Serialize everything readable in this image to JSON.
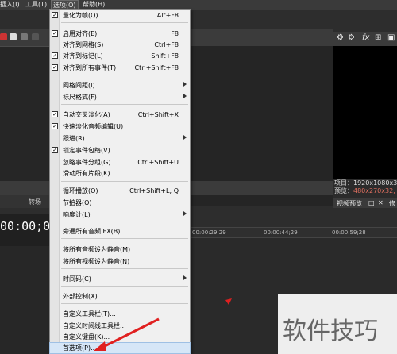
{
  "menubar": {
    "items": [
      "插入(I)",
      "工具(T)",
      "选项(O)",
      "帮助(H)"
    ]
  },
  "menu": {
    "items": [
      {
        "label": "量化为帧(Q)",
        "shortcut": "Alt+F8",
        "checked": true
      },
      {
        "label": "启用对齐(E)",
        "shortcut": "F8",
        "checked": true
      },
      {
        "label": "对齐到网格(S)",
        "shortcut": "Ctrl+F8",
        "checked": false
      },
      {
        "label": "对齐到标记(L)",
        "shortcut": "Shift+F8",
        "checked": true
      },
      {
        "label": "对齐到所有事件(T)",
        "shortcut": "Ctrl+Shift+F8",
        "checked": true
      },
      {
        "label": "网格间距(I)",
        "shortcut": "",
        "checked": false,
        "submenu": true
      },
      {
        "label": "标尺格式(F)",
        "shortcut": "",
        "checked": false,
        "submenu": true
      },
      {
        "label": "自动交叉淡化(A)",
        "shortcut": "Ctrl+Shift+X",
        "checked": true
      },
      {
        "label": "快速淡化音频编辑(U)",
        "shortcut": "",
        "checked": true
      },
      {
        "label": "跟进(R)",
        "shortcut": "",
        "checked": false,
        "submenu": true
      },
      {
        "label": "锁定事件包络(V)",
        "shortcut": "",
        "checked": true
      },
      {
        "label": "忽略事件分组(G)",
        "shortcut": "Ctrl+Shift+U",
        "checked": false
      },
      {
        "label": "滑动所有片段(K)",
        "shortcut": "",
        "checked": false
      },
      {
        "label": "循环播放(O)",
        "shortcut": "Ctrl+Shift+L; Q",
        "checked": false
      },
      {
        "label": "节拍器(O)",
        "shortcut": "",
        "checked": false
      },
      {
        "label": "响度计(L)",
        "shortcut": "",
        "checked": false,
        "submenu": true
      },
      {
        "label": "旁通所有音频 FX(B)",
        "shortcut": "",
        "checked": false
      },
      {
        "label": "将所有音频设为静音(M)",
        "shortcut": "",
        "checked": false
      },
      {
        "label": "将所有视频设为静音(N)",
        "shortcut": "",
        "checked": false
      },
      {
        "label": "时间码(C)",
        "shortcut": "",
        "checked": false,
        "submenu": true
      },
      {
        "label": "外部控制(X)",
        "shortcut": "",
        "checked": false
      },
      {
        "label": "自定义工具栏(T)...",
        "shortcut": "",
        "checked": false
      },
      {
        "label": "自定义时间线工具栏...",
        "shortcut": "",
        "checked": false
      },
      {
        "label": "自定义键盘(K)...",
        "shortcut": "",
        "checked": false
      },
      {
        "label": "首选项(P)...",
        "shortcut": "",
        "checked": false,
        "highlighted": true
      }
    ]
  },
  "left": {
    "tab_label": "转场",
    "timecode": "00:00;00"
  },
  "ruler": {
    "ticks": [
      "00:00:29;29",
      "00:00:44;29",
      "00:00:59;28"
    ]
  },
  "right": {
    "project_info": "项目：1920x1080x32",
    "preview_info_label": "预览：",
    "preview_info_value": "480x270x32, 2",
    "tab_label": "视频预览",
    "tab_extra": "修"
  },
  "watermark": "软件技巧",
  "colors": {
    "menu_bg": "#f0f0f0",
    "app_bg": "#2d2d2d",
    "arrow": "#e02020"
  }
}
